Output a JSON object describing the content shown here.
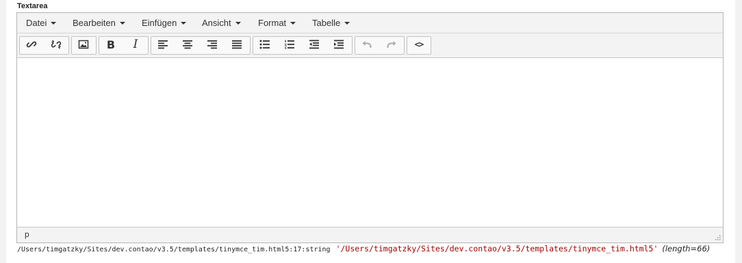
{
  "field": {
    "label": "Textarea"
  },
  "menubar": {
    "items": [
      {
        "label": "Datei"
      },
      {
        "label": "Bearbeiten"
      },
      {
        "label": "Einfügen"
      },
      {
        "label": "Ansicht"
      },
      {
        "label": "Format"
      },
      {
        "label": "Tabelle"
      }
    ]
  },
  "toolbar": {
    "buttons": [
      {
        "icon": "link-icon"
      },
      {
        "icon": "unlink-icon"
      },
      {
        "icon": "image-icon"
      },
      {
        "icon": "bold-icon",
        "glyph": "B"
      },
      {
        "icon": "italic-icon",
        "glyph": "I"
      },
      {
        "icon": "align-left-icon"
      },
      {
        "icon": "align-center-icon"
      },
      {
        "icon": "align-right-icon"
      },
      {
        "icon": "align-justify-icon"
      },
      {
        "icon": "bullet-list-icon"
      },
      {
        "icon": "numbered-list-icon"
      },
      {
        "icon": "outdent-icon"
      },
      {
        "icon": "indent-icon"
      },
      {
        "icon": "undo-icon"
      },
      {
        "icon": "redo-icon"
      },
      {
        "icon": "source-code-icon",
        "glyph": "<>"
      }
    ]
  },
  "statusbar": {
    "path": "p"
  },
  "debug": {
    "location": "/Users/timgatzky/Sites/dev.contao/v3.5/templates/tinymce_tim.html5:17:string",
    "value": "'/Users/timgatzky/Sites/dev.contao/v3.5/templates/tinymce_tim.html5'",
    "length": "(length=66)"
  },
  "colors": {
    "string": "#a40000",
    "toolbar_bg": "#f3f3f3",
    "border": "#b5b5b5"
  }
}
